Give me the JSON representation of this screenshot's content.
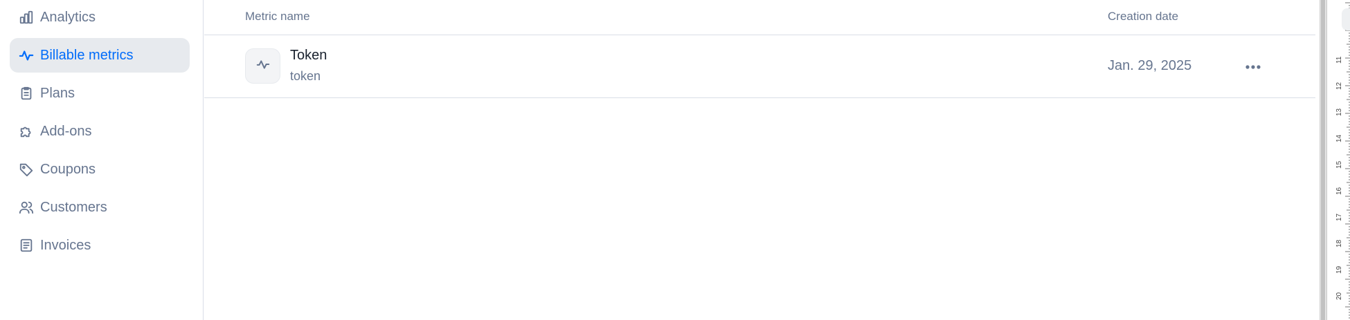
{
  "sidebar": {
    "items": [
      {
        "label": "Analytics",
        "icon": "bar-chart-icon"
      },
      {
        "label": "Billable metrics",
        "icon": "pulse-icon",
        "active": true
      },
      {
        "label": "Plans",
        "icon": "clipboard-icon"
      },
      {
        "label": "Add-ons",
        "icon": "puzzle-icon"
      },
      {
        "label": "Coupons",
        "icon": "tag-icon"
      },
      {
        "label": "Customers",
        "icon": "users-icon"
      },
      {
        "label": "Invoices",
        "icon": "document-icon"
      }
    ]
  },
  "table": {
    "columns": [
      "Metric name",
      "Creation date"
    ],
    "rows": [
      {
        "name": "Token",
        "code": "token",
        "created": "Jan. 29, 2025",
        "icon": "pulse-icon"
      }
    ]
  },
  "ruler": {
    "labels": [
      "11",
      "12",
      "13",
      "14",
      "15",
      "16",
      "17",
      "18",
      "19",
      "20"
    ]
  },
  "colors": {
    "accent": "#006cfa",
    "muted_text": "#66758f",
    "active_bg": "#e7eaee",
    "border": "#d9dee7"
  }
}
